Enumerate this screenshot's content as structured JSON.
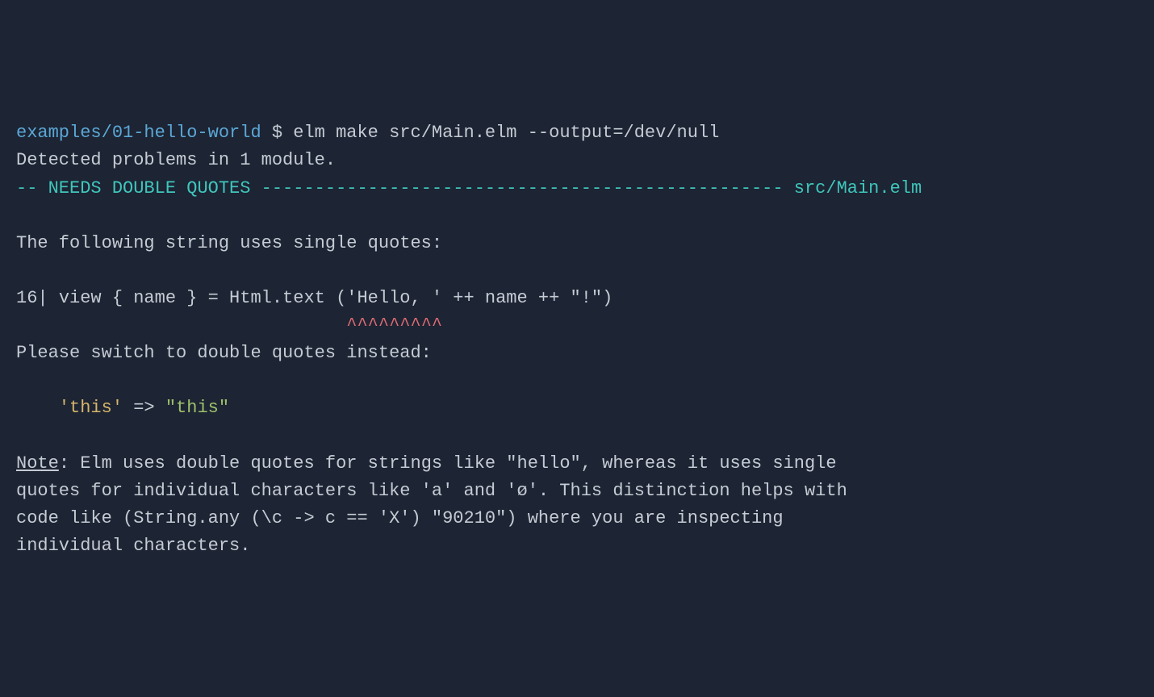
{
  "prompt": {
    "path": "examples/01-hello-world",
    "separator": " $ ",
    "command": "elm make src/Main.elm --output=/dev/null"
  },
  "detected": "Detected problems in 1 module.",
  "error_header": {
    "prefix": "-- ",
    "title": "NEEDS DOUBLE QUOTES",
    "dashes": " ------------------------------------------------- ",
    "file": "src/Main.elm"
  },
  "desc_line": "The following string uses single quotes:",
  "code": {
    "line_no": "16| ",
    "body": "view { name } = Html.text ('Hello, ' ++ name ++ \"!\")",
    "caret_pad": "                               ",
    "caret": "^^^^^^^^^"
  },
  "instruct": "Please switch to double quotes instead:",
  "example": {
    "pad": "    ",
    "single": "'this'",
    "arrow": " => ",
    "double": "\"this\""
  },
  "note": {
    "label": "Note",
    "colon": ": ",
    "line1": "Elm uses double quotes for strings like \"hello\", whereas it uses single",
    "line2": "quotes for individual characters like 'a' and 'ø'. This distinction helps with",
    "line3": "code like (String.any (\\c -> c == 'X') \"90210\") where you are inspecting",
    "line4": "individual characters."
  }
}
